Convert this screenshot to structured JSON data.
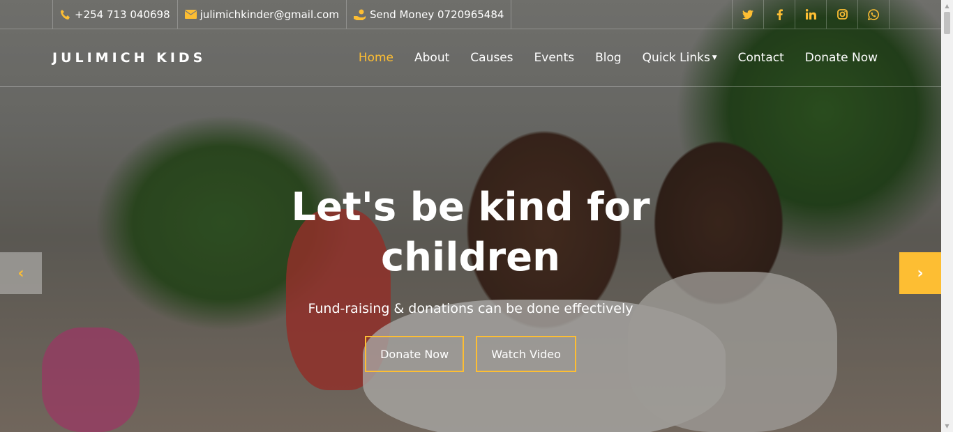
{
  "topbar": {
    "phone": "+254 713 040698",
    "email": "julimichkinder@gmail.com",
    "money": "Send Money 0720965484",
    "social": [
      "twitter-icon",
      "facebook-icon",
      "linkedin-icon",
      "instagram-icon",
      "whatsapp-icon"
    ]
  },
  "nav": {
    "brand": "JULIMICH KIDS",
    "items": [
      "Home",
      "About",
      "Causes",
      "Events",
      "Blog",
      "Quick Links",
      "Contact",
      "Donate Now"
    ]
  },
  "hero": {
    "title": "Let's be kind for children",
    "subtitle": "Fund-raising & donations can be done effectively",
    "primary_btn": "Donate Now",
    "secondary_btn": "Watch Video"
  },
  "colors": {
    "accent": "#fdbe33",
    "text": "#ffffff"
  }
}
